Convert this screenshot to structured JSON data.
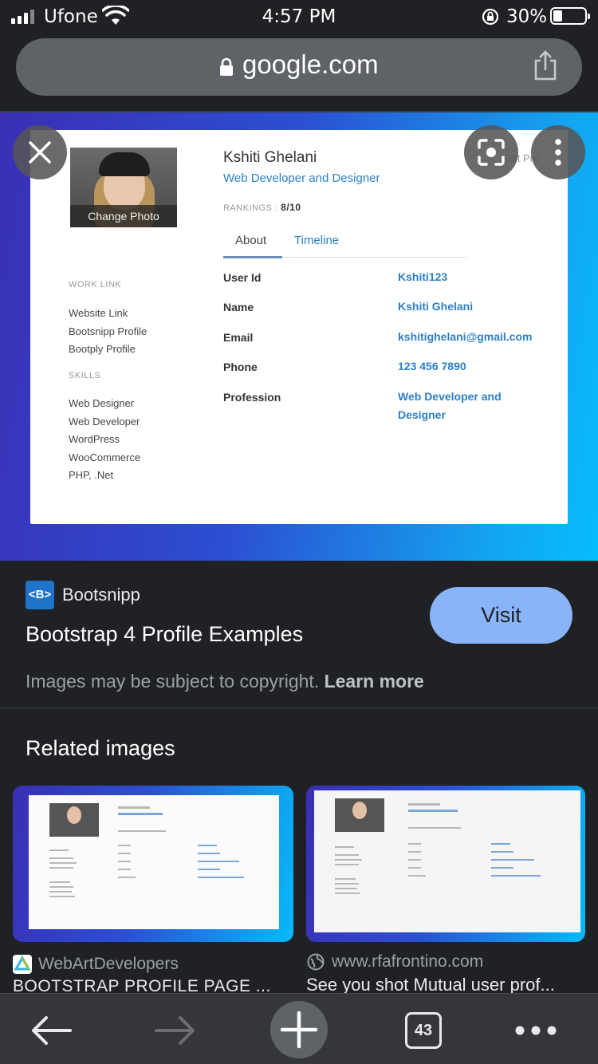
{
  "status_bar": {
    "carrier": "Ufone",
    "time": "4:57 PM",
    "battery_percent": "30%",
    "battery_level": 0.3,
    "icons": [
      "signal-icon",
      "wifi-icon",
      "rotation-lock-icon",
      "battery-icon"
    ]
  },
  "url_bar": {
    "domain": "google.com",
    "icons": [
      "lock-icon",
      "share-icon"
    ]
  },
  "preview": {
    "overlay_icons": [
      "close-icon",
      "lens-icon",
      "more-vert-icon"
    ],
    "profile": {
      "photo_caption": "Change Photo",
      "name": "Kshiti Ghelani",
      "role": "Web Developer and Designer",
      "rankings_label": "RANKINGS :",
      "rankings_value": "8/10",
      "edit_button": "Edit Pro",
      "work_link_label": "WORK LINK",
      "work_links": [
        "Website Link",
        "Bootsnipp Profile",
        "Bootply Profile"
      ],
      "skills_label": "SKILLS",
      "skills": [
        "Web Designer",
        "Web Developer",
        "WordPress",
        "WooCommerce",
        "PHP, .Net"
      ],
      "tabs": [
        "About",
        "Timeline"
      ],
      "fields": [
        {
          "label": "User Id",
          "value": "Kshiti123"
        },
        {
          "label": "Name",
          "value": "Kshiti Ghelani"
        },
        {
          "label": "Email",
          "value": "kshitighelani@gmail.com"
        },
        {
          "label": "Phone",
          "value": "123 456 7890"
        },
        {
          "label": "Profession",
          "value": "Web Developer and Designer"
        }
      ]
    }
  },
  "result": {
    "source_logo": "<B>",
    "source_name": "Bootsnipp",
    "title": "Bootstrap 4 Profile Examples",
    "visit_label": "Visit",
    "copyright_text": "Images may be subject to copyright.",
    "learn_more": "Learn more"
  },
  "related": {
    "heading": "Related images",
    "items": [
      {
        "source": "WebArtDevelopers",
        "title": "BOOTSTRAP PROFILE PAGE ..."
      },
      {
        "source": "www.rfafrontino.com",
        "title": "See you shot Mutual user prof..."
      }
    ]
  },
  "toolbar": {
    "tabs_count": "43",
    "icons": [
      "back-arrow-icon",
      "forward-arrow-icon",
      "new-tab-plus-icon",
      "tab-switcher-icon",
      "more-horiz-icon"
    ]
  },
  "colors": {
    "background": "#202124",
    "accent": "#8ab4f8",
    "link_blue": "#2b7fc6"
  }
}
